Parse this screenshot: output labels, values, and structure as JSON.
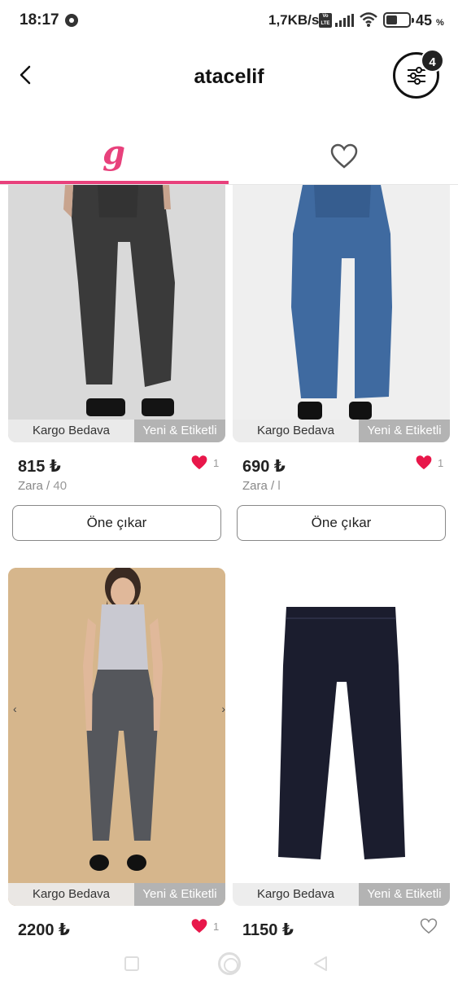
{
  "status_bar": {
    "time": "18:17",
    "speed": "1,7KB/s",
    "volte": "Vo LTE",
    "battery_percent": "45",
    "percent_sign": "%"
  },
  "header": {
    "title": "atacelif",
    "filter_count": "4"
  },
  "tabs": {
    "active_logo": "g",
    "accent_color": "#e8417c"
  },
  "products": [
    {
      "price": "815 ₺",
      "brand": "Zara",
      "size": "40",
      "likes": "1",
      "liked": true,
      "label_left": "Kargo Bedava",
      "label_right": "Yeni & Etiketli",
      "promote_label": "Öne çıkar"
    },
    {
      "price": "690 ₺",
      "brand": "Zara",
      "size": "l",
      "likes": "1",
      "liked": true,
      "label_left": "Kargo Bedava",
      "label_right": "Yeni & Etiketli",
      "promote_label": "Öne çıkar"
    },
    {
      "price": "2200 ₺",
      "likes": "1",
      "liked": true,
      "label_left": "Kargo Bedava",
      "label_right": "Yeni & Etiketli"
    },
    {
      "price": "1150 ₺",
      "liked": false,
      "label_left": "Kargo Bedava",
      "label_right": "Yeni & Etiketli"
    }
  ],
  "icons": {
    "back": "chevron-left-icon",
    "filter": "sliders-icon",
    "favorites": "heart-outline-icon",
    "like": "heart-filled-icon"
  }
}
